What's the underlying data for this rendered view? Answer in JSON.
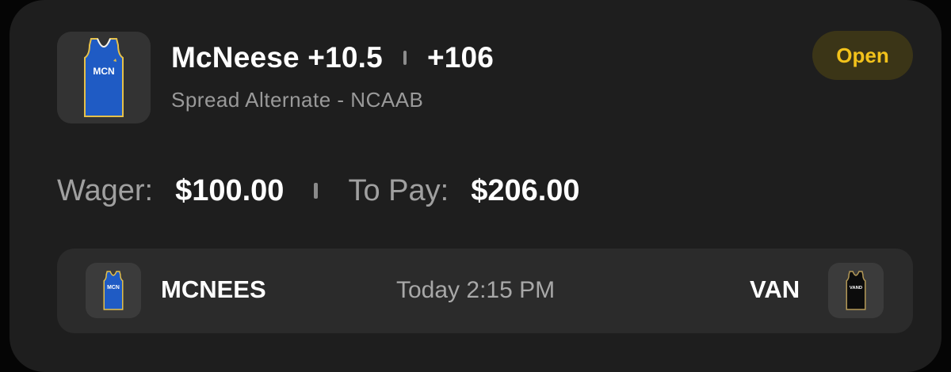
{
  "bet": {
    "team_line": "McNeese +10.5",
    "odds": "+106",
    "market": "Spread Alternate - NCAAB",
    "status": "Open",
    "jersey_text": "MCN"
  },
  "amounts": {
    "wager_label": "Wager:",
    "wager_value": "$100.00",
    "topay_label": "To Pay:",
    "topay_value": "$206.00"
  },
  "game": {
    "home_team": "MCNEES",
    "home_jersey_text": "MCN",
    "time": "Today 2:15 PM",
    "away_team": "VAN",
    "away_jersey_text": "VAND"
  },
  "colors": {
    "card_bg": "#1e1e1e",
    "status_text": "#f2c21b",
    "status_bg": "#3b3517",
    "mcneese_blue": "#1f5bc4",
    "vanderbilt_black": "#0c0c0c",
    "vanderbilt_gold": "#b59a57"
  },
  "icons": {
    "main_jersey": "mcneese-jersey-icon",
    "home_jersey": "mcneese-jersey-icon",
    "away_jersey": "vanderbilt-jersey-icon"
  }
}
